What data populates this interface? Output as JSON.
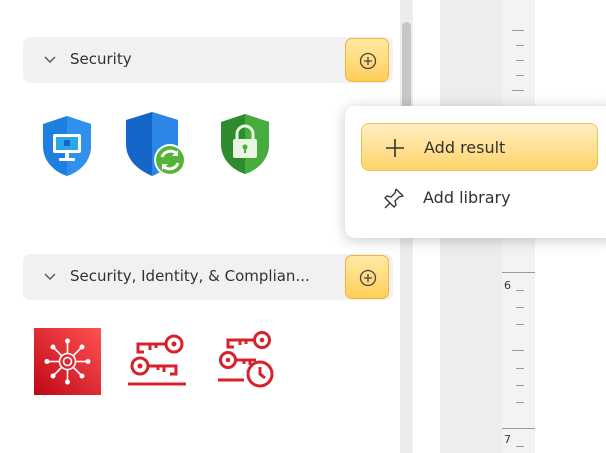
{
  "sections": [
    {
      "title": "Security",
      "add_button_icon": "plus-circle-icon",
      "shapes": [
        "azure-defender-monitor-shield-icon",
        "azure-shield-refresh-icon",
        "green-lock-shield-icon"
      ]
    },
    {
      "title": "Security, Identity, & Complian...",
      "add_button_icon": "plus-circle-icon",
      "shapes": [
        "aws-security-hub-icon",
        "aws-key-management-icon",
        "aws-secrets-rotation-keys-icon"
      ]
    }
  ],
  "context_menu": {
    "items": [
      {
        "label": "Add result",
        "icon": "plus-icon",
        "active": true
      },
      {
        "label": "Add library",
        "icon": "pin-icon",
        "active": false
      }
    ]
  },
  "ruler": {
    "labels": [
      "6",
      "7"
    ]
  },
  "colors": {
    "accent_yellow": "#ffcf59",
    "aws_red": "#d6232b",
    "azure_blue": "#1f7fe0",
    "green": "#3ea33a"
  }
}
